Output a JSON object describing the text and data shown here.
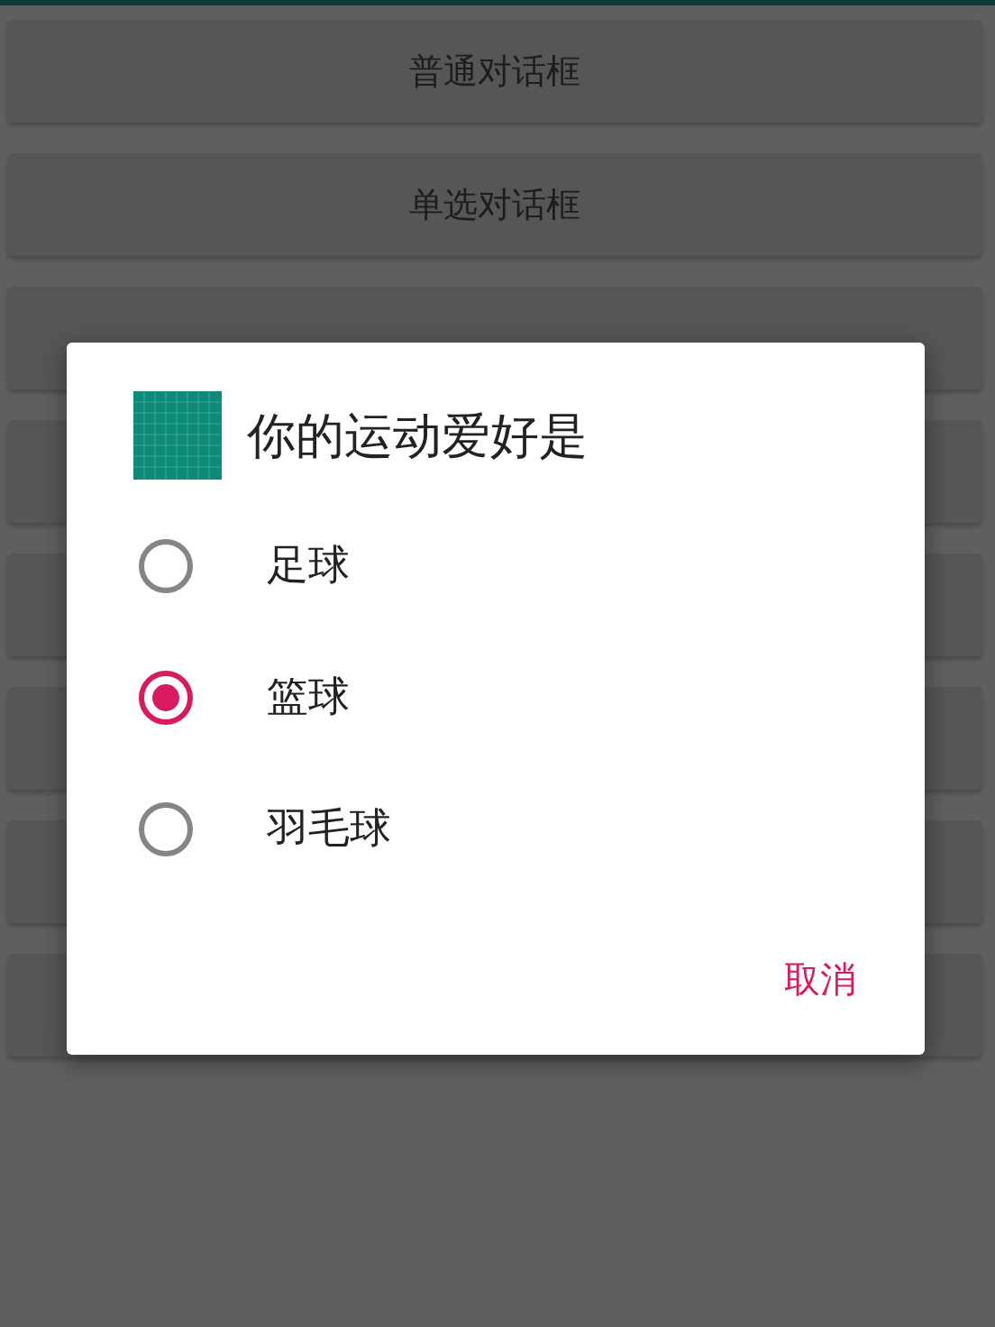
{
  "buttons": [
    {
      "kind": "labeled",
      "label": "普通对话框"
    },
    {
      "kind": "labeled",
      "label": "单选对话框"
    },
    {
      "kind": "covered"
    },
    {
      "kind": "covered"
    },
    {
      "kind": "covered"
    },
    {
      "kind": "covered"
    },
    {
      "kind": "covered"
    },
    {
      "kind": "covered"
    }
  ],
  "dialog": {
    "title": "你的运动爱好是",
    "options": [
      {
        "label": "足球",
        "selected": false
      },
      {
        "label": "篮球",
        "selected": true
      },
      {
        "label": "羽毛球",
        "selected": false
      }
    ],
    "actions": [
      "取消"
    ]
  }
}
